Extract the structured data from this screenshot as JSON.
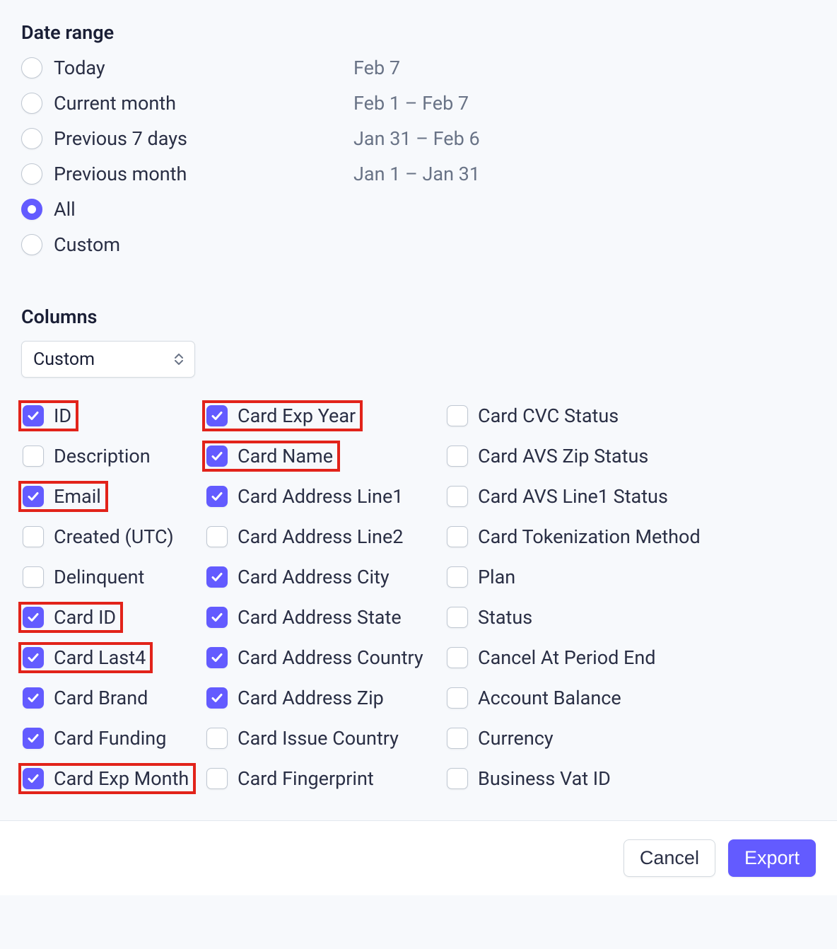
{
  "dateRange": {
    "title": "Date range",
    "options": [
      {
        "id": "today",
        "label": "Today",
        "date": "Feb 7",
        "selected": false
      },
      {
        "id": "month",
        "label": "Current month",
        "date": "Feb 1 – Feb 7",
        "selected": false
      },
      {
        "id": "prev7",
        "label": "Previous 7 days",
        "date": "Jan 31 – Feb 6",
        "selected": false
      },
      {
        "id": "prevmo",
        "label": "Previous month",
        "date": "Jan 1 – Jan 31",
        "selected": false
      },
      {
        "id": "all",
        "label": "All",
        "date": "",
        "selected": true
      },
      {
        "id": "custom",
        "label": "Custom",
        "date": "",
        "selected": false
      }
    ]
  },
  "columnsSection": {
    "title": "Columns",
    "preset": "Custom"
  },
  "columns": {
    "col0": [
      {
        "id": "id",
        "label": "ID",
        "checked": true,
        "highlight": true
      },
      {
        "id": "description",
        "label": "Description",
        "checked": false,
        "highlight": false
      },
      {
        "id": "email",
        "label": "Email",
        "checked": true,
        "highlight": true
      },
      {
        "id": "created",
        "label": "Created (UTC)",
        "checked": false,
        "highlight": false
      },
      {
        "id": "delinquent",
        "label": "Delinquent",
        "checked": false,
        "highlight": false
      },
      {
        "id": "card-id",
        "label": "Card ID",
        "checked": true,
        "highlight": true
      },
      {
        "id": "card-last4",
        "label": "Card Last4",
        "checked": true,
        "highlight": true
      },
      {
        "id": "card-brand",
        "label": "Card Brand",
        "checked": true,
        "highlight": false
      },
      {
        "id": "card-funding",
        "label": "Card Funding",
        "checked": true,
        "highlight": false
      },
      {
        "id": "card-exp-month",
        "label": "Card Exp Month",
        "checked": true,
        "highlight": true
      }
    ],
    "col1": [
      {
        "id": "card-exp-year",
        "label": "Card Exp Year",
        "checked": true,
        "highlight": true
      },
      {
        "id": "card-name",
        "label": "Card Name",
        "checked": true,
        "highlight": true
      },
      {
        "id": "card-addr-line1",
        "label": "Card Address Line1",
        "checked": true,
        "highlight": false
      },
      {
        "id": "card-addr-line2",
        "label": "Card Address Line2",
        "checked": false,
        "highlight": false
      },
      {
        "id": "card-addr-city",
        "label": "Card Address City",
        "checked": true,
        "highlight": false
      },
      {
        "id": "card-addr-state",
        "label": "Card Address State",
        "checked": true,
        "highlight": false
      },
      {
        "id": "card-addr-country",
        "label": "Card Address Country",
        "checked": true,
        "highlight": false
      },
      {
        "id": "card-addr-zip",
        "label": "Card Address Zip",
        "checked": true,
        "highlight": false
      },
      {
        "id": "card-issue-country",
        "label": "Card Issue Country",
        "checked": false,
        "highlight": false
      },
      {
        "id": "card-fingerprint",
        "label": "Card Fingerprint",
        "checked": false,
        "highlight": false
      }
    ],
    "col2": [
      {
        "id": "card-cvc-status",
        "label": "Card CVC Status",
        "checked": false,
        "highlight": false
      },
      {
        "id": "card-avs-zip",
        "label": "Card AVS Zip Status",
        "checked": false,
        "highlight": false
      },
      {
        "id": "card-avs-line1",
        "label": "Card AVS Line1 Status",
        "checked": false,
        "highlight": false
      },
      {
        "id": "card-token-method",
        "label": "Card Tokenization Method",
        "checked": false,
        "highlight": false
      },
      {
        "id": "plan",
        "label": "Plan",
        "checked": false,
        "highlight": false
      },
      {
        "id": "status",
        "label": "Status",
        "checked": false,
        "highlight": false
      },
      {
        "id": "cancel-period-end",
        "label": "Cancel At Period End",
        "checked": false,
        "highlight": false
      },
      {
        "id": "account-balance",
        "label": "Account Balance",
        "checked": false,
        "highlight": false
      },
      {
        "id": "currency",
        "label": "Currency",
        "checked": false,
        "highlight": false
      },
      {
        "id": "business-vat-id",
        "label": "Business Vat ID",
        "checked": false,
        "highlight": false
      }
    ]
  },
  "footer": {
    "cancel": "Cancel",
    "export": "Export"
  }
}
